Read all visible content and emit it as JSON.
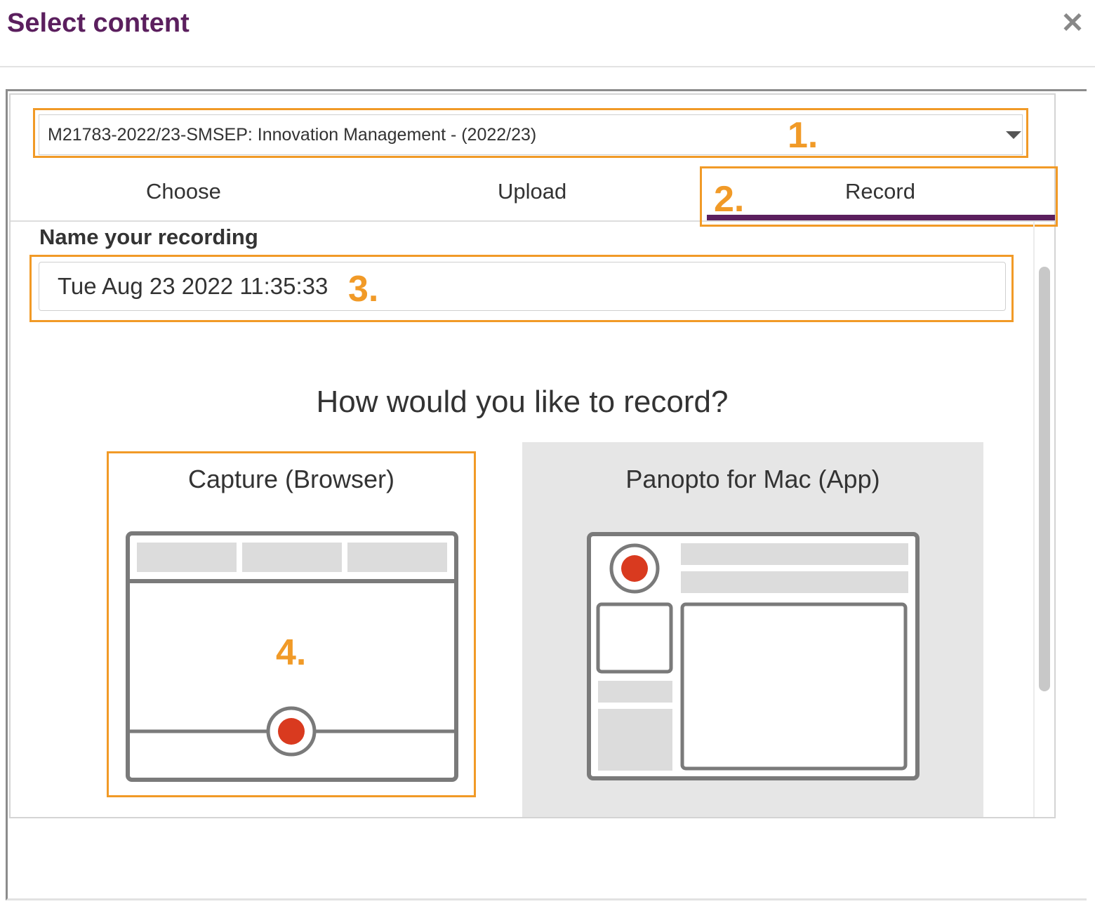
{
  "dialog": {
    "title": "Select content",
    "close_symbol": "✕"
  },
  "folder": {
    "selected": "M21783-2022/23-SMSEP: Innovation Management - (2022/23)"
  },
  "tabs": [
    {
      "label": "Choose",
      "active": false
    },
    {
      "label": "Upload",
      "active": false
    },
    {
      "label": "Record",
      "active": true
    }
  ],
  "record": {
    "name_label": "Name your recording",
    "name_value": "Tue Aug 23 2022 11:35:33",
    "prompt": "How would you like to record?",
    "options": [
      {
        "label": "Capture (Browser)",
        "icon": "browser-window-record-icon"
      },
      {
        "label": "Panopto for Mac (App)",
        "icon": "app-window-record-icon"
      }
    ]
  },
  "annotations": {
    "step1": "1.",
    "step2": "2.",
    "step3": "3.",
    "step4": "4."
  },
  "colors": {
    "brand_purple": "#5b1f5e",
    "annotation_orange": "#f19a27",
    "record_red": "#d93a1f",
    "option_selected_bg": "#e6e6e6"
  }
}
